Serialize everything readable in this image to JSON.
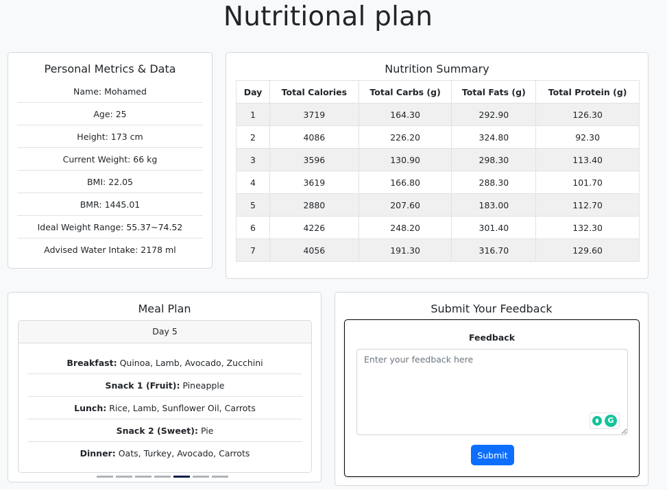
{
  "page_title": "Nutritional plan",
  "metrics": {
    "title": "Personal Metrics & Data",
    "items": [
      "Name: Mohamed",
      "Age: 25",
      "Height: 173 cm",
      "Current Weight: 66 kg",
      "BMI: 22.05",
      "BMR: 1445.01",
      "Ideal Weight Range: 55.37~74.52",
      "Advised Water Intake: 2178 ml"
    ]
  },
  "summary": {
    "title": "Nutrition Summary",
    "headers": [
      "Day",
      "Total Calories",
      "Total Carbs (g)",
      "Total Fats (g)",
      "Total Protein (g)"
    ],
    "rows": [
      [
        "1",
        "3719",
        "164.30",
        "292.90",
        "126.30"
      ],
      [
        "2",
        "4086",
        "226.20",
        "324.80",
        "92.30"
      ],
      [
        "3",
        "3596",
        "130.90",
        "298.30",
        "113.40"
      ],
      [
        "4",
        "3619",
        "166.80",
        "288.30",
        "101.70"
      ],
      [
        "5",
        "2880",
        "207.60",
        "183.00",
        "112.70"
      ],
      [
        "6",
        "4226",
        "248.20",
        "301.40",
        "132.30"
      ],
      [
        "7",
        "4056",
        "191.30",
        "316.70",
        "129.60"
      ]
    ]
  },
  "meal_plan": {
    "title": "Meal Plan",
    "day_label": "Day 5",
    "meals": [
      {
        "label": "Breakfast:",
        "value": "Quinoa, Lamb, Avocado, Zucchini"
      },
      {
        "label": "Snack 1 (Fruit):",
        "value": "Pineapple"
      },
      {
        "label": "Lunch:",
        "value": "Rice, Lamb, Sunflower Oil, Carrots"
      },
      {
        "label": "Snack 2 (Sweet):",
        "value": "Pie"
      },
      {
        "label": "Dinner:",
        "value": "Oats, Turkey, Avocado, Carrots"
      }
    ],
    "carousel_active_index": 4,
    "carousel_count": 7
  },
  "feedback": {
    "title": "Submit Your Feedback",
    "label": "Feedback",
    "placeholder": "Enter your feedback here",
    "submit_label": "Submit"
  }
}
